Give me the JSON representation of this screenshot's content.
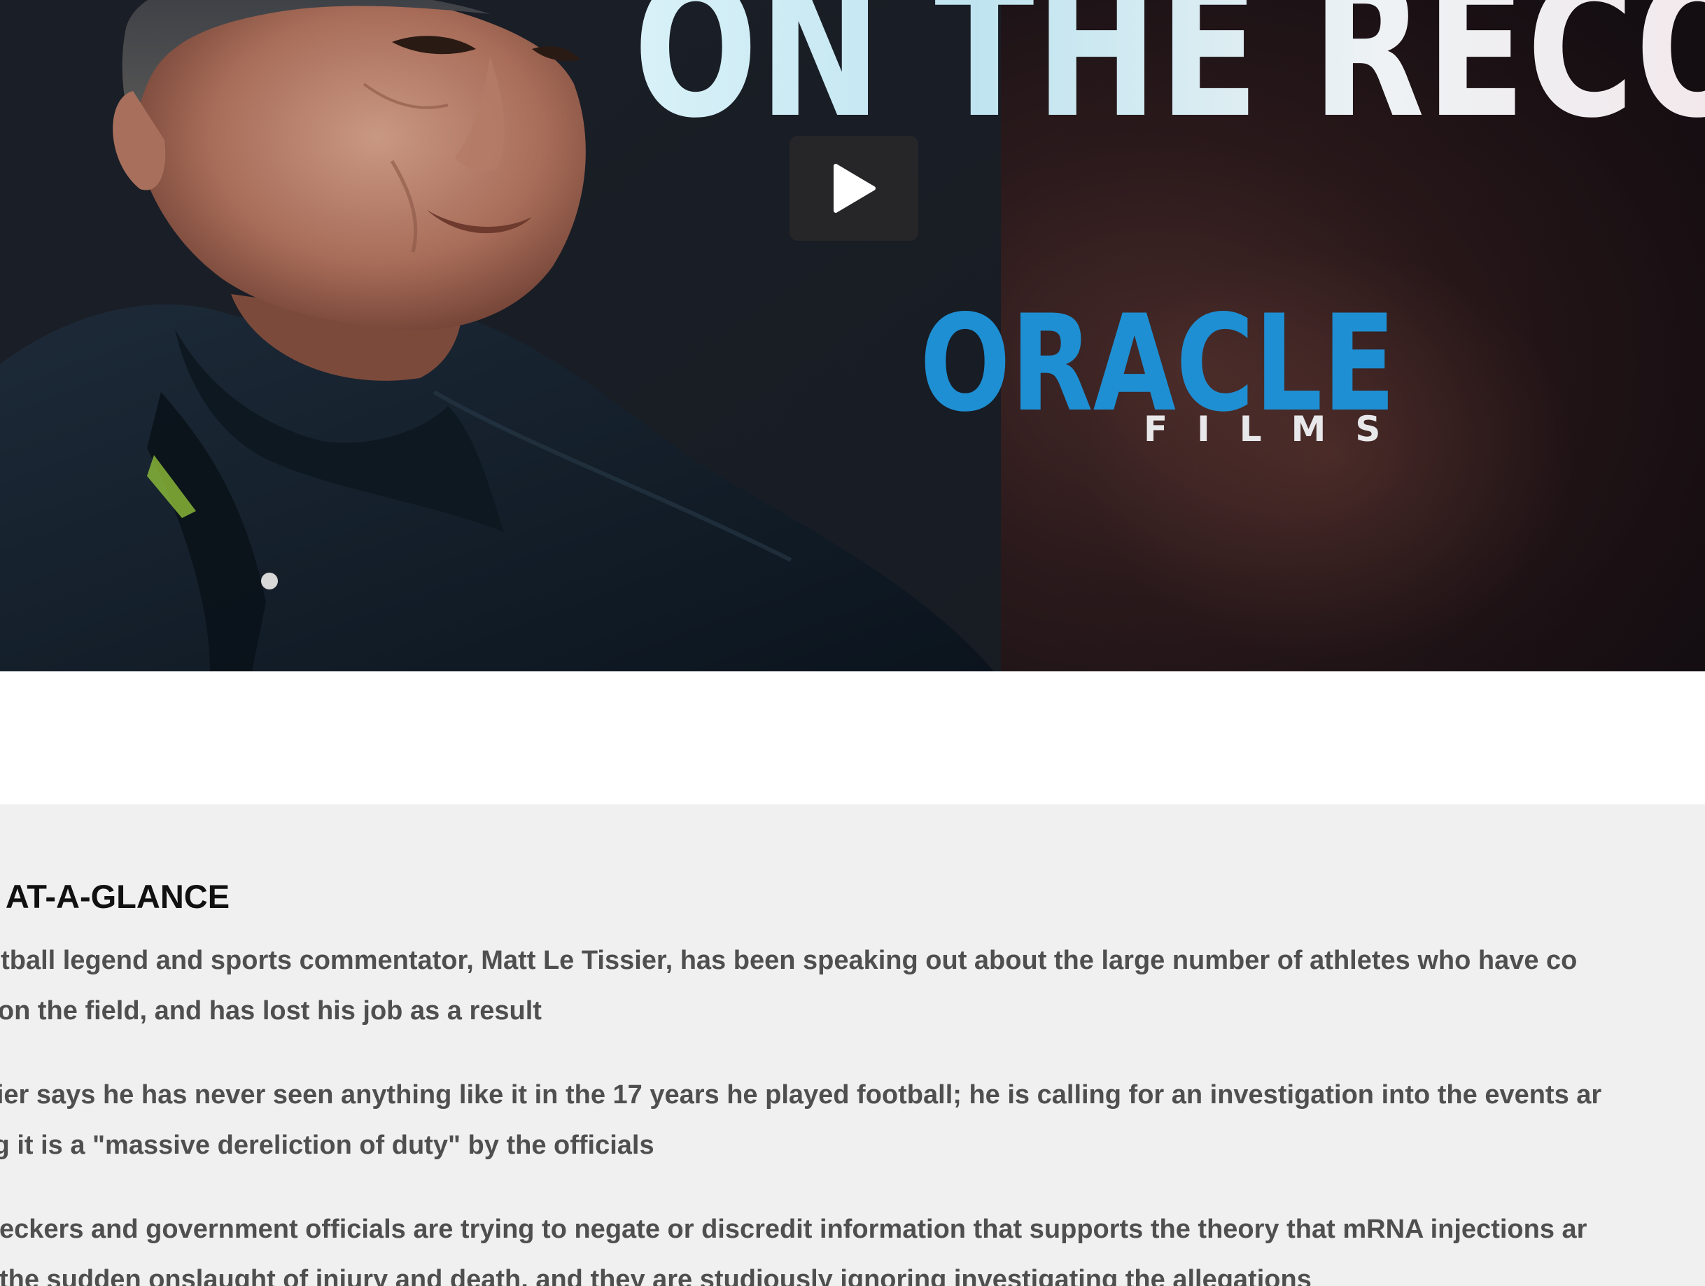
{
  "video": {
    "headline": "ON THE RECORD",
    "play_label": "Play video",
    "logo": {
      "brand": "ORACLE",
      "sub": "FILMS",
      "color": "#1e8fd3"
    }
  },
  "summary": {
    "title": "Y AT-A-GLANCE",
    "items": [
      {
        "line1": "football legend and sports commentator, Matt Le Tissier, has been speaking out about the large number of athletes who have co",
        "line2": "ed on the field, and has lost his job as a result"
      },
      {
        "line1": "issier says he has never seen anything like it in the 17 years he played football; he is calling for an investigation into the events ar",
        "line2": "ring it is a \"massive dereliction of duty\" by the officials"
      },
      {
        "line1": "-checkers and government officials are trying to negate or discredit information that supports the theory that mRNA injections ar",
        "line2": "nd the sudden onslaught of injury and death, and they are studiously ignoring investigating the allegations"
      }
    ]
  },
  "colors": {
    "summary_background": "#f0f0f0",
    "summary_text": "#4f4f4f",
    "play_button": "#262628"
  }
}
